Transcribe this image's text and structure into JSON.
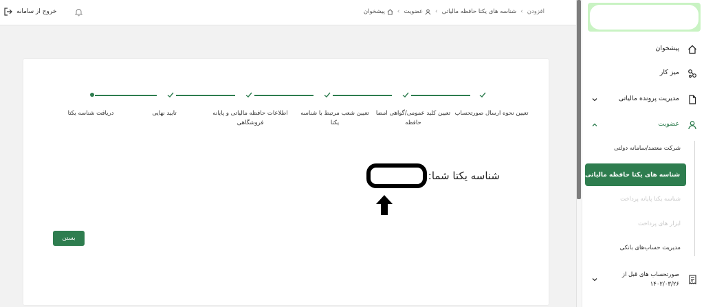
{
  "header": {
    "logout_label": "خروج از سامانه",
    "breadcrumb": [
      {
        "label": "پیشخوان",
        "icon": "home-icon"
      },
      {
        "label": "عضویت",
        "icon": "user-icon"
      },
      {
        "label": "شناسه های یکتا حافظه مالیاتی",
        "icon": ""
      },
      {
        "label": "افزودن",
        "icon": ""
      }
    ]
  },
  "sidebar": {
    "items": [
      {
        "label": "پیشخوان",
        "icon": "home-icon"
      },
      {
        "label": "میز کار",
        "icon": "workflow-icon"
      },
      {
        "label": "مدیریت پرونده مالیاتی",
        "icon": "file-icon"
      },
      {
        "label": "عضویت",
        "icon": "user-icon"
      }
    ],
    "submenu": [
      {
        "label": "شرکت معتمد/سامانه دولتی",
        "state": "normal"
      },
      {
        "label": "شناسه های یکتا حافظه مالیاتی",
        "state": "active"
      },
      {
        "label": "شناسه یکتا پایانه پرداخت",
        "state": "disabled"
      },
      {
        "label": "ابزار های پرداخت",
        "state": "disabled"
      },
      {
        "label": "مدیریت حساب‌های بانکی",
        "state": "normal"
      }
    ],
    "invoice_item": {
      "label_line1": "صورتحساب های قبل از",
      "label_line2": "۱۴۰۲/۰۳/۲۶",
      "icon": "receipt-icon"
    }
  },
  "wizard": {
    "steps": [
      {
        "label": "تعیین نحوه ارسال صورتحساب",
        "status": "done"
      },
      {
        "label": "تعیین کلید عمومی/گواهی امضا حافظه",
        "status": "done"
      },
      {
        "label": "تعیین شعب مرتبط با شناسه یکتا",
        "status": "done"
      },
      {
        "label": "اطلاعات حافظه مالیاتی و پایانه فروشگاهی",
        "status": "done"
      },
      {
        "label": "تایید نهایی",
        "status": "done"
      },
      {
        "label": "دریافت شناسه یکتا",
        "status": "current"
      }
    ],
    "result_label": "شناسه یکتا شما:",
    "close_label": "بستن"
  },
  "colors": {
    "accent": "#2e7d4f",
    "logo_bg": "#c9f3c3"
  }
}
